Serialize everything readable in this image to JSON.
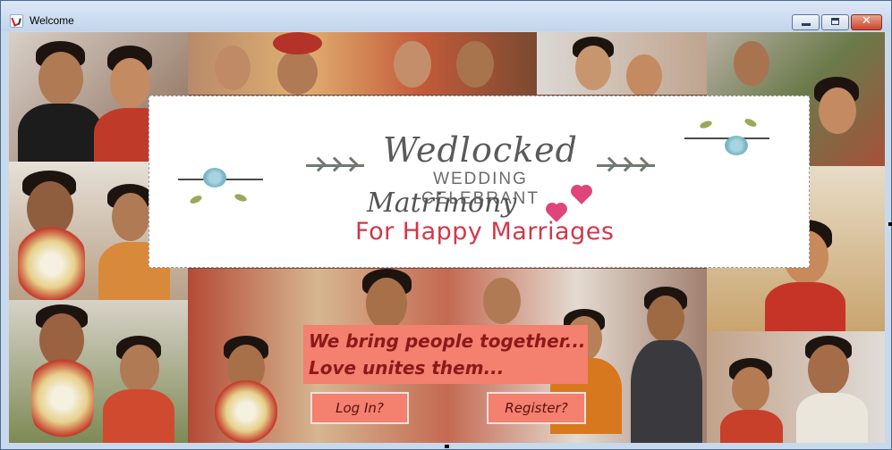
{
  "window": {
    "title": "Welcome",
    "minimize_icon": "minimize-icon",
    "maximize_icon": "maximize-icon",
    "close_label": "✕"
  },
  "banner": {
    "brand_name": "Wedlocked",
    "brand_sub": "WEDDING CELEBRANT",
    "brand_matrimony": "Matrimony",
    "tagline": "For Happy Marriages",
    "colors": {
      "tagline": "#d1384a",
      "script": "#555555"
    }
  },
  "message": {
    "line1": "We bring people together...",
    "line2": "Love unites them..."
  },
  "actions": {
    "login_label": "Log In?",
    "register_label": "Register?"
  },
  "colors": {
    "accent": "#f4806f",
    "accent_text": "#8a1a1a"
  }
}
